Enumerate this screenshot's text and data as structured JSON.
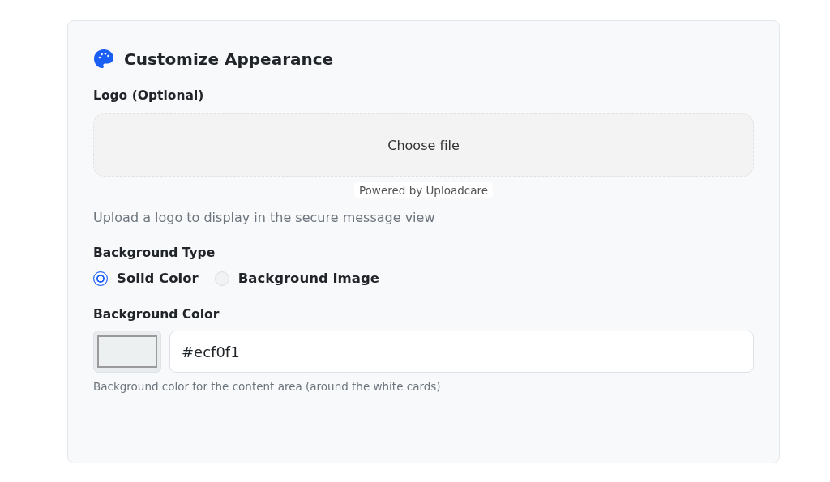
{
  "section": {
    "title": "Customize Appearance"
  },
  "logo": {
    "label": "Logo (Optional)",
    "button": "Choose file",
    "powered_by": "Powered by Uploadcare",
    "help": "Upload a logo to display in the secure message view"
  },
  "background_type": {
    "label": "Background Type",
    "options": [
      {
        "label": "Solid Color",
        "selected": true
      },
      {
        "label": "Background Image",
        "selected": false
      }
    ]
  },
  "background_color": {
    "label": "Background Color",
    "value": "#ecf0f1",
    "help": "Background color for the content area (around the white cards)"
  }
}
